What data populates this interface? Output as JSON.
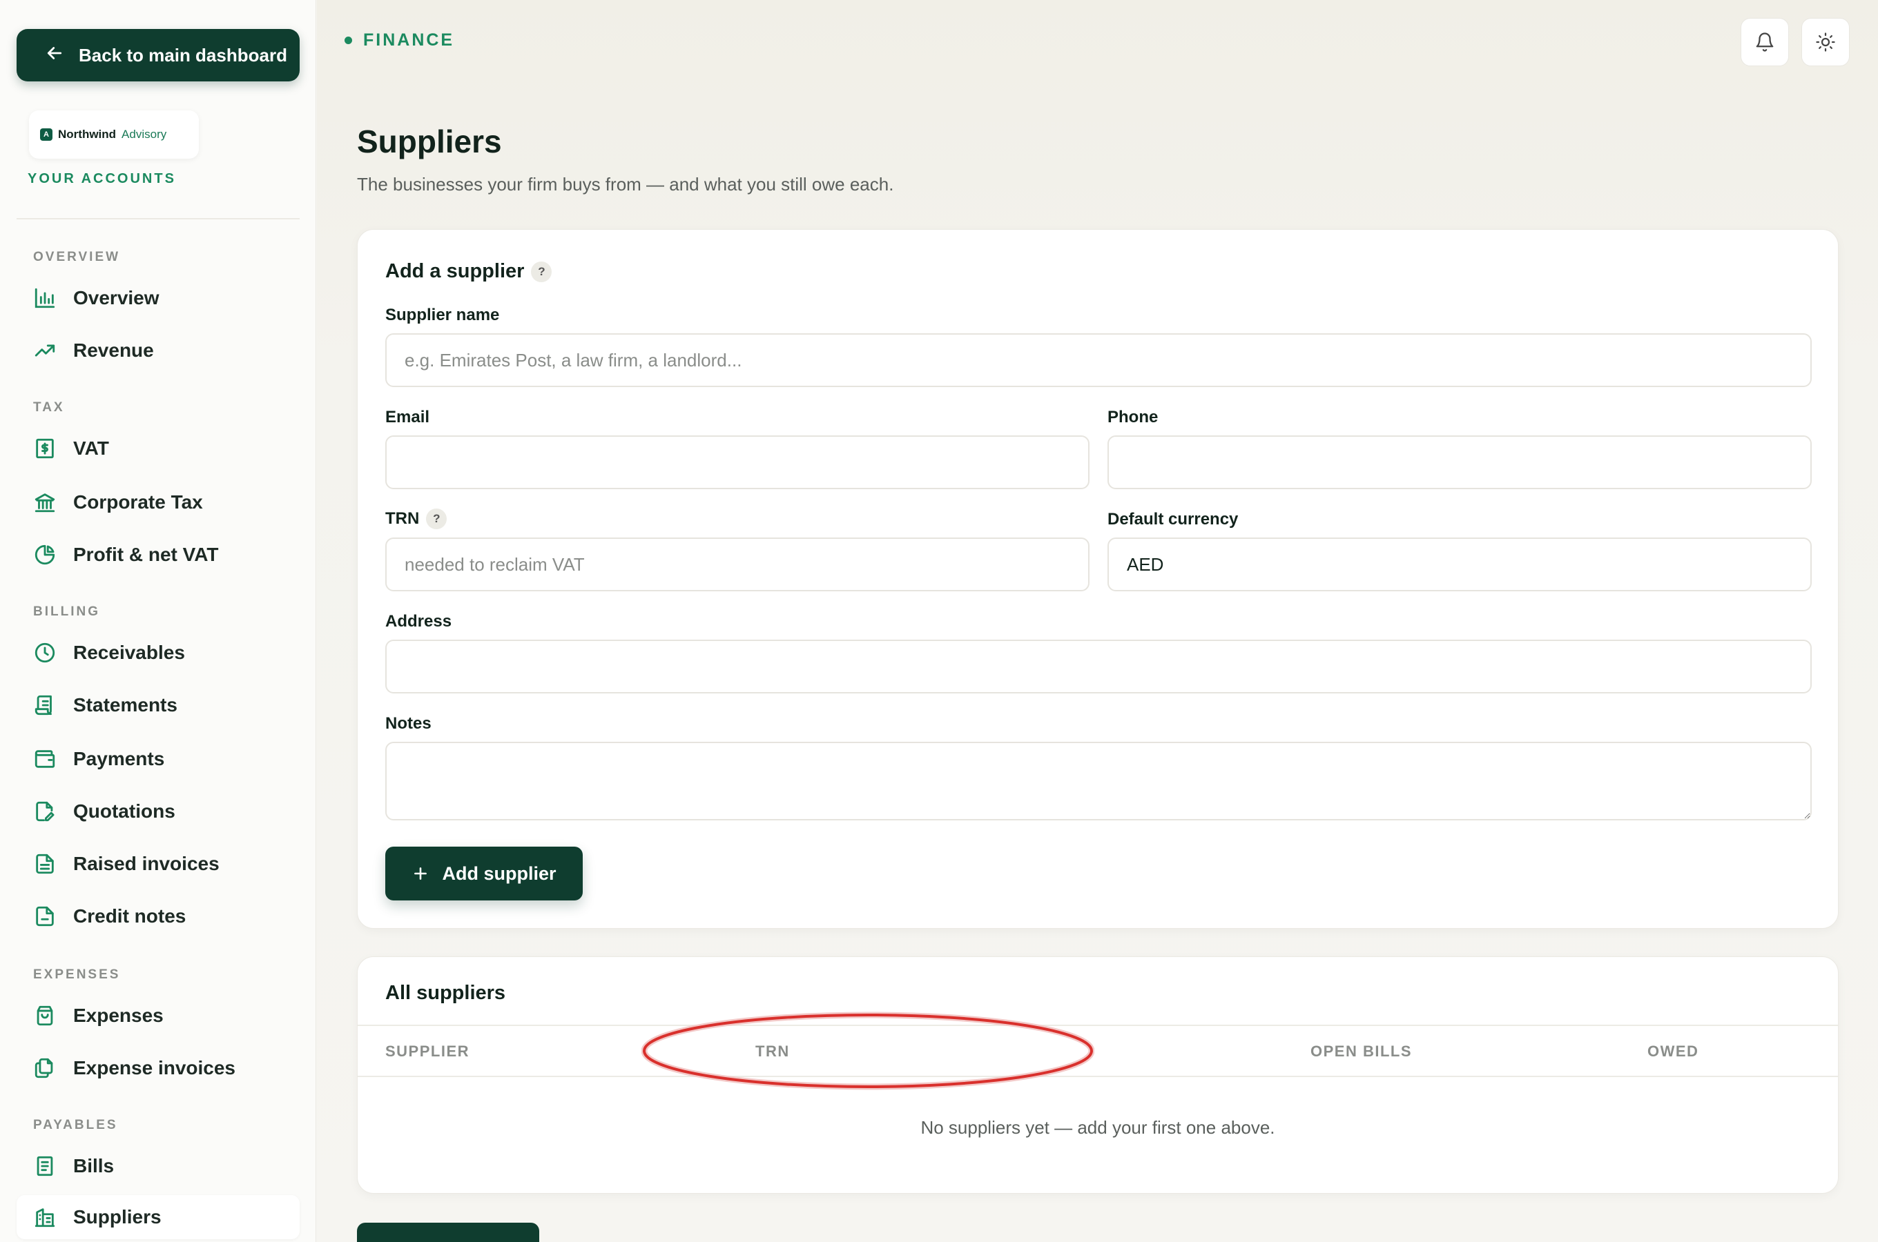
{
  "sidebar": {
    "back_label": "Back to main dashboard",
    "brand": {
      "logo_letter": "A",
      "name": "Northwind",
      "sub": "Advisory"
    },
    "accounts_label": "YOUR ACCOUNTS",
    "sections": {
      "overview": "OVERVIEW",
      "tax": "TAX",
      "billing": "BILLING",
      "expenses": "EXPENSES",
      "payables": "PAYABLES"
    },
    "items": {
      "overview": "Overview",
      "revenue": "Revenue",
      "vat": "VAT",
      "corporate_tax": "Corporate Tax",
      "profit_vat": "Profit & net VAT",
      "receivables": "Receivables",
      "statements": "Statements",
      "payments": "Payments",
      "quotations": "Quotations",
      "raised_invoices": "Raised invoices",
      "credit_notes": "Credit notes",
      "expenses": "Expenses",
      "expense_invoices": "Expense invoices",
      "bills": "Bills",
      "suppliers": "Suppliers"
    },
    "active_item": "suppliers"
  },
  "header": {
    "breadcrumb": "FINANCE",
    "icons": [
      "bell-icon",
      "sun-icon"
    ]
  },
  "page": {
    "title": "Suppliers",
    "subtitle": "The businesses your firm buys from — and what you still owe each."
  },
  "form": {
    "title": "Add a supplier",
    "help": "?",
    "supplier_name": {
      "label": "Supplier name",
      "placeholder": "e.g. Emirates Post, a law firm, a landlord...",
      "value": ""
    },
    "email": {
      "label": "Email",
      "value": ""
    },
    "phone": {
      "label": "Phone",
      "value": ""
    },
    "trn": {
      "label": "TRN",
      "placeholder": "needed to reclaim VAT",
      "value": ""
    },
    "currency": {
      "label": "Default currency",
      "value": "AED"
    },
    "address": {
      "label": "Address",
      "value": ""
    },
    "notes": {
      "label": "Notes",
      "value": ""
    },
    "submit_label": "Add supplier"
  },
  "table": {
    "title": "All suppliers",
    "columns": [
      "SUPPLIER",
      "TRN",
      "OPEN BILLS",
      "OWED"
    ],
    "rows": [],
    "empty_text": "No suppliers yet — add your first one above."
  },
  "colors": {
    "accent": "#1b8a5f",
    "primary_button": "#0f3d2f",
    "highlight_ring": "#d9302c"
  }
}
